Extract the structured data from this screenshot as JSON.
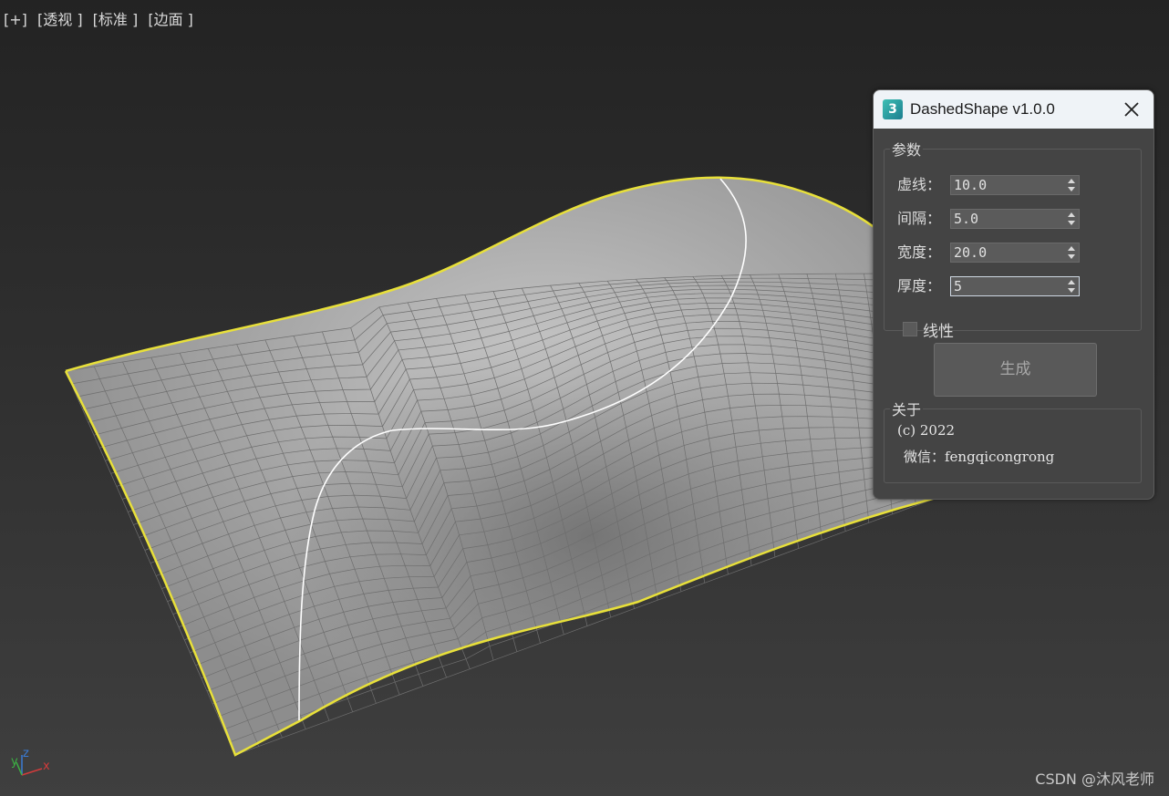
{
  "viewport": {
    "menu": [
      "[+]",
      "[透视 ]",
      "[标准 ]",
      "[边面 ]"
    ],
    "axis": {
      "x": "x",
      "y": "y",
      "z": "z"
    },
    "colors": {
      "selection_edge": "#e8e03a",
      "spline": "#ffffff",
      "mesh": "#b4b4b4"
    }
  },
  "watermark": "CSDN @沐风老师",
  "dialog": {
    "icon": "3ds-max-app-icon",
    "icon_text": "3",
    "title": "DashedShape v1.0.0",
    "params": {
      "legend": "参数",
      "fields": [
        {
          "label": "虚线：",
          "value": "10.0"
        },
        {
          "label": "间隔：",
          "value": "5.0"
        },
        {
          "label": "宽度：",
          "value": "20.0"
        },
        {
          "label": "厚度：",
          "value": "5"
        }
      ],
      "checkbox_label": "线性",
      "checkbox_checked": false
    },
    "generate_label": "生成",
    "about": {
      "legend": "关于",
      "copyright": "(c) 2022",
      "wechat": "微信：fengqicongrong"
    }
  }
}
